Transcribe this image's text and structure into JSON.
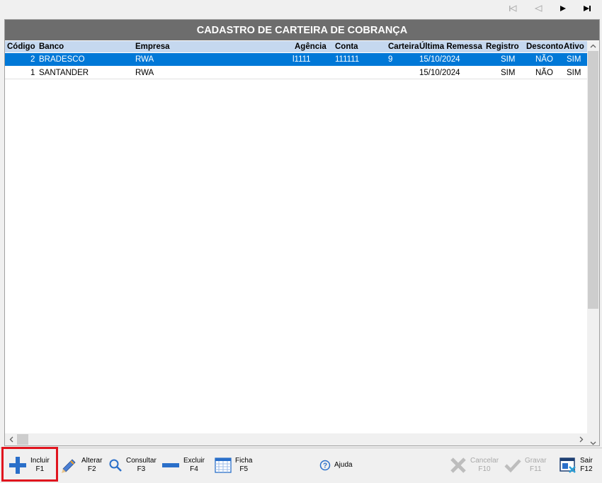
{
  "nav": {
    "first": "⏮",
    "prev": "◀",
    "next": "▶",
    "last": "⏭"
  },
  "title": "CADASTRO DE CARTEIRA DE COBRANÇA",
  "columns": [
    "Código",
    "Banco",
    "Empresa",
    "Agência",
    "Conta",
    "Carteira",
    "Última Remessa",
    "Registro",
    "Desconto",
    "Ativo"
  ],
  "rows": [
    {
      "codigo": "2",
      "banco": "BRADESCO",
      "empresa": "RWA",
      "agencia": "l1111",
      "conta": "111111",
      "carteira": "9",
      "ultima_remessa": "15/10/2024",
      "registro": "SIM",
      "desconto": "NÃO",
      "ativo": "SIM"
    },
    {
      "codigo": "1",
      "banco": "SANTANDER",
      "empresa": "RWA",
      "agencia": "",
      "conta": "",
      "carteira": "",
      "ultima_remessa": "15/10/2024",
      "registro": "SIM",
      "desconto": "NÃO",
      "ativo": "SIM"
    }
  ],
  "toolbar": {
    "incluir": {
      "label": "Incluir",
      "key": "F1"
    },
    "alterar": {
      "label": "Alterar",
      "key": "F2"
    },
    "consultar": {
      "label": "Consultar",
      "key": "F3"
    },
    "excluir": {
      "label": "Excluir",
      "key": "F4"
    },
    "ficha": {
      "label": "Ficha",
      "key": "F5"
    },
    "ajuda": {
      "label": "Ajuda"
    },
    "cancelar": {
      "label": "Cancelar",
      "key": "F10"
    },
    "gravar": {
      "label": "Gravar",
      "key": "F11"
    },
    "sair": {
      "label": "Sair",
      "key": "F12"
    }
  },
  "colors": {
    "title_bg": "#6d6d6d",
    "header_bg": "#c5d8ef",
    "selected_row": "#0078d7",
    "highlight": "#e0141e"
  }
}
